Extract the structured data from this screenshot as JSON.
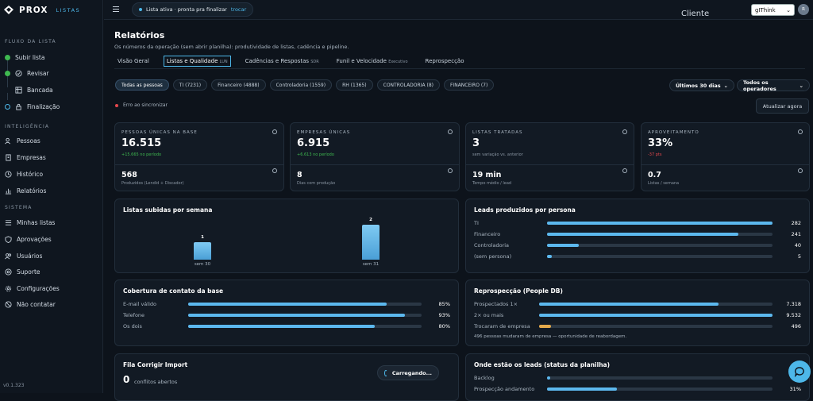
{
  "app": {
    "brand": "PROX",
    "brand_sub": "LISTAS",
    "version": "v0.1.323"
  },
  "sidebar": {
    "section_flow": "FLUXO DA LISTA",
    "flow": [
      {
        "label": "Subir lista",
        "state": "done"
      },
      {
        "label": "Revisar",
        "state": "done"
      },
      {
        "label": "Bancada",
        "state": "todo"
      },
      {
        "label": "Finalização",
        "state": "current"
      }
    ],
    "section_intel": "INTELIGÊNCIA",
    "intel": [
      {
        "label": "Pessoas",
        "icon": "people-icon"
      },
      {
        "label": "Empresas",
        "icon": "building-icon"
      },
      {
        "label": "Histórico",
        "icon": "clock-icon"
      },
      {
        "label": "Relatórios",
        "icon": "chart-icon"
      }
    ],
    "section_sys": "SISTEMA",
    "sys": [
      {
        "label": "Minhas listas",
        "icon": "list-icon"
      },
      {
        "label": "Aprovações",
        "icon": "shield-icon"
      },
      {
        "label": "Usuários",
        "icon": "users-icon"
      },
      {
        "label": "Suporte",
        "icon": "support-icon"
      },
      {
        "label": "Configurações",
        "icon": "gear-icon"
      },
      {
        "label": "Não contatar",
        "icon": "block-icon"
      }
    ]
  },
  "topbar": {
    "status_text": "Lista ativa · pronta pra finalizar",
    "status_link": "trocar",
    "cliente_label": "Cliente",
    "client_select": "gIThink",
    "avatar": "R"
  },
  "page": {
    "title": "Relatórios",
    "subtitle": "Os números da operação (sem abrir planilha): produtividade de listas, cadência e pipeline.",
    "tabs": [
      {
        "label": "Visão Geral",
        "badge": ""
      },
      {
        "label": "Listas e Qualidade",
        "badge": "LUN"
      },
      {
        "label": "Cadências e Respostas",
        "badge": "SDR"
      },
      {
        "label": "Funil e Velocidade",
        "badge": "Executivo"
      },
      {
        "label": "Reprospecção",
        "badge": ""
      }
    ],
    "chips": [
      "Todas as pessoas",
      "TI (7231)",
      "Financeiro (4888)",
      "Controladoria (1559)",
      "RH (1365)",
      "CONTROLADORIA (8)",
      "FINANCEIRO (7)"
    ],
    "period": "Últimos 30 dias",
    "operators": "Todos os operadores",
    "error_text": "Erro ao sincronizar",
    "refresh": "Atualizar agora"
  },
  "kpis": [
    {
      "label": "PESSOAS ÚNICAS NA BASE",
      "value": "16.515",
      "sub": "+15.665 no período",
      "tone": "pos",
      "value2": "568",
      "sub2": "Produzidos (Lendid + Discador)"
    },
    {
      "label": "EMPRESAS ÚNICAS",
      "value": "6.915",
      "sub": "+6.613 no período",
      "tone": "pos",
      "value2": "8",
      "sub2": "Dias com produção"
    },
    {
      "label": "LISTAS TRATADAS",
      "value": "3",
      "sub": "sem variação vs. anterior",
      "tone": "neutral",
      "value2": "19 min",
      "sub2": "Tempo médio / lead"
    },
    {
      "label": "APROVEITAMENTO",
      "value": "33%",
      "sub": "-37 pts",
      "tone": "neg",
      "value2": "0.7",
      "sub2": "Listas / semana"
    }
  ],
  "weekly": {
    "title": "Listas subidas por semana",
    "chart_data": {
      "type": "bar",
      "categories": [
        "sem 30",
        "sem 31"
      ],
      "values": [
        1,
        2
      ],
      "title": "Listas subidas por semana"
    }
  },
  "leads_persona": {
    "title": "Leads produzidos por persona",
    "rows": [
      {
        "label": "TI",
        "value": "282",
        "ratio": 1.0
      },
      {
        "label": "Financeiro",
        "value": "241",
        "ratio": 0.85
      },
      {
        "label": "Controladoria",
        "value": "40",
        "ratio": 0.14
      },
      {
        "label": "(sem persona)",
        "value": "5",
        "ratio": 0.02
      }
    ]
  },
  "coverage": {
    "title": "Cobertura de contato da base",
    "rows": [
      {
        "label": "E-mail válido",
        "value": "85%",
        "ratio": 0.85
      },
      {
        "label": "Telefone",
        "value": "93%",
        "ratio": 0.93
      },
      {
        "label": "Os dois",
        "value": "80%",
        "ratio": 0.8
      }
    ]
  },
  "reprospect": {
    "title": "Reprospecção (People DB)",
    "rows": [
      {
        "label": "Prospectados 1×",
        "value": "7.318",
        "ratio": 0.77
      },
      {
        "label": "2× ou mais",
        "value": "9.532",
        "ratio": 1.0
      },
      {
        "label": "Trocaram de empresa",
        "value": "496",
        "ratio": 0.05
      }
    ],
    "note": "496 pessoas mudaram de empresa — oportunidade de reabordagem."
  },
  "fix_import": {
    "title": "Fila Corrigir Import",
    "count": "0",
    "count_label": "conflitos abertos"
  },
  "lead_status": {
    "title": "Onde estão os leads (status da planilha)",
    "rows": [
      {
        "label": "Backlog",
        "value": "",
        "ratio": 0.01
      },
      {
        "label": "Prospecção andamento",
        "value": "31%",
        "ratio": 0.31
      }
    ]
  },
  "loading": "Carregando...",
  "colors": {
    "accent": "#4db7e9",
    "bar": "#5cb8ee",
    "warn": "#e3a94b",
    "pos": "#3fb950",
    "neg": "#e5484d"
  }
}
